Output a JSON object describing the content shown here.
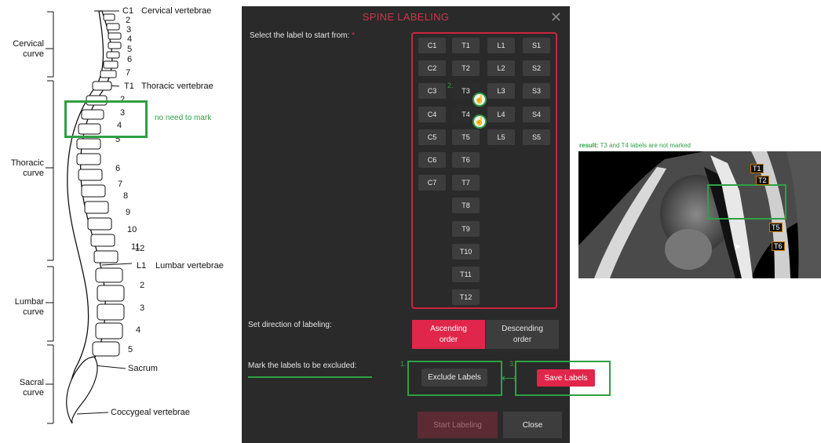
{
  "diagram": {
    "left_labels": {
      "cervical_vertebrae": "Cervical vertebrae",
      "thoracic_vertebrae": "Thoracic vertebrae",
      "lumbar_vertebrae": "Lumbar vertebrae",
      "sacrum": "Sacrum",
      "coccygeal_vertebrae": "Coccygeal vertebrae",
      "cervical_curve": "Cervical\ncurve",
      "thoracic_curve": "Thoracic\ncurve",
      "lumbar_curve": "Lumbar\ncurve",
      "sacral_curve": "Sacral\ncurve"
    },
    "markers": {
      "c1": "C1",
      "t1": "T1",
      "l1": "L1",
      "n2a": "2",
      "n3a": "3",
      "n4a": "4",
      "n5a": "5",
      "n6a": "6",
      "n7a": "7",
      "n2b": "2",
      "n3b": "3",
      "n4b": "4",
      "n5b": "5",
      "n6b": "6",
      "n7b": "7",
      "n8b": "8",
      "n9b": "9",
      "n10b": "10",
      "n11b": "11",
      "n12b": "12",
      "n2c": "2",
      "n3c": "3",
      "n4c": "4",
      "n5c": "5"
    },
    "note": "no need to  mark"
  },
  "dialog": {
    "title": "SPINE LABELING",
    "close_glyph": "✕",
    "select_label": "Select the label to start from:",
    "required_mark": "*",
    "columns": {
      "c": [
        "C1",
        "C2",
        "C3",
        "C4",
        "C5",
        "C6",
        "C7"
      ],
      "t": [
        "T1",
        "T2",
        "T3",
        "T4",
        "T5",
        "T6",
        "T7",
        "T8",
        "T9",
        "T10",
        "T11",
        "T12"
      ],
      "l": [
        "L1",
        "L2",
        "L3",
        "L4",
        "L5"
      ],
      "s": [
        "S1",
        "S2",
        "S3",
        "S4",
        "S5"
      ]
    },
    "step2": "2.",
    "direction_label": "Set direction of labeling:",
    "ascending": "Ascending\norder",
    "descending": "Descending\norder",
    "exclude_label": "Mark the labels to be excluded:",
    "step1": "1.",
    "step3": "3.",
    "exclude_button": "Exclude Labels",
    "save_button": "Save Labels",
    "start_button": "Start Labeling",
    "close_button": "Close",
    "arrow_glyph": "⟷"
  },
  "result": {
    "caption_bold": "result:",
    "caption_rest": " T3 and T4 labels are not marked",
    "tags": [
      "T1",
      "T2",
      "T5",
      "T6"
    ]
  },
  "colors": {
    "accent_red": "#e0264a",
    "annotation_green": "#2ea043",
    "dialog_bg": "#2a2a2a"
  }
}
